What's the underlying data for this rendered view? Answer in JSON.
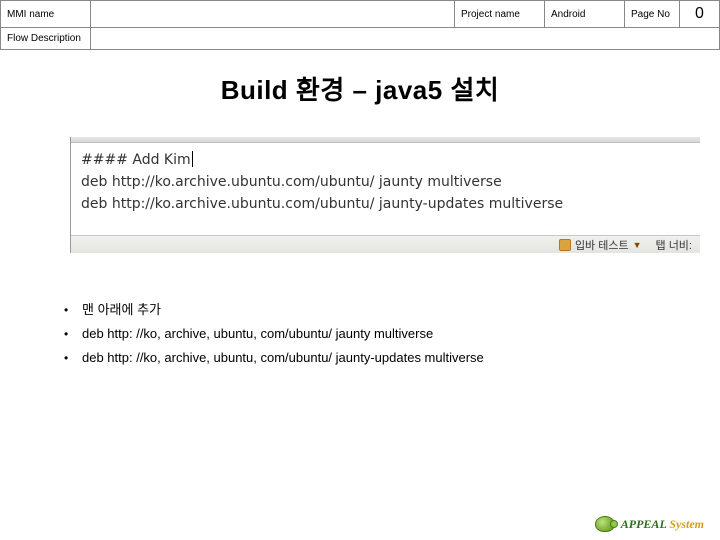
{
  "header": {
    "mmi_label": "MMI name",
    "mmi_value": "",
    "project_label": "Project name",
    "project_value": "Android",
    "page_label": "Page No",
    "page_value": "0",
    "flow_label": "Flow Description",
    "flow_value": ""
  },
  "title": "Build 환경 – java5 설치",
  "editor": {
    "lines": [
      "#### Add Kim",
      "deb http://ko.archive.ubuntu.com/ubuntu/ jaunty multiverse",
      "deb http://ko.archive.ubuntu.com/ubuntu/ jaunty-updates multiverse"
    ],
    "status_left": "입바 테스트",
    "status_right": "탭 너비:"
  },
  "bullets": [
    "맨 아래에 추가",
    "deb http: //ko, archive, ubuntu, com/ubuntu/ jaunty multiverse",
    "deb http: //ko, archive, ubuntu, com/ubuntu/ jaunty-updates multiverse"
  ],
  "footer": {
    "brand_a": "APPEAL",
    "brand_b": "System"
  }
}
